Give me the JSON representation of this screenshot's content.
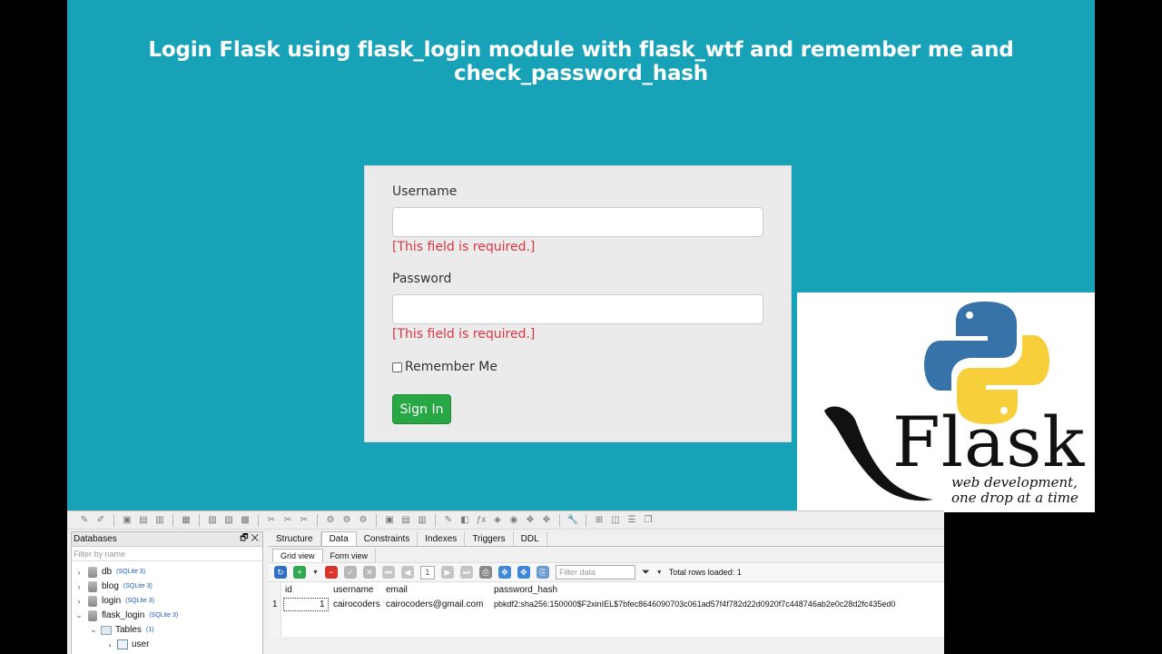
{
  "page": {
    "title": "Login Flask using flask_login module with flask_wtf and remember me and check_password_hash"
  },
  "form": {
    "username_label": "Username",
    "username_error": "[This field is required.]",
    "password_label": "Password",
    "password_error": "[This field is required.]",
    "remember_label": "Remember Me",
    "submit_label": "Sign In"
  },
  "logo": {
    "word": "Flask",
    "tagline_1": "web development,",
    "tagline_2": "one drop at a time"
  },
  "sqlitestudio": {
    "databases_panel": {
      "title": "Databases",
      "filter_placeholder": "Filter by name",
      "items": [
        {
          "name": "db",
          "tag": "(SQLite 3)"
        },
        {
          "name": "blog",
          "tag": "(SQLite 3)"
        },
        {
          "name": "login",
          "tag": "(SQLite 3)"
        },
        {
          "name": "flask_login",
          "tag": "(SQLite 3)"
        }
      ],
      "tables_label": "Tables",
      "tables_count": "(1)",
      "table_name": "user"
    },
    "tabs": [
      "Structure",
      "Data",
      "Constraints",
      "Indexes",
      "Triggers",
      "DDL"
    ],
    "active_tab": "Data",
    "subtabs": [
      "Grid view",
      "Form view"
    ],
    "page_number": "1",
    "filter_placeholder": "Filter data",
    "total_rows": "Total rows loaded: 1",
    "grid": {
      "columns": [
        "id",
        "username",
        "email",
        "password_hash"
      ],
      "row_number": "1",
      "row": {
        "id": "1",
        "username": "cairocoders",
        "email": "cairocoders@gmail.com",
        "password_hash": "pbkdf2:sha256:150000$F2xinIEL$7bfec8646090703c061ad57f4f782d22d0920f7c448746ab2e0c28d2fc435ed0"
      }
    }
  }
}
